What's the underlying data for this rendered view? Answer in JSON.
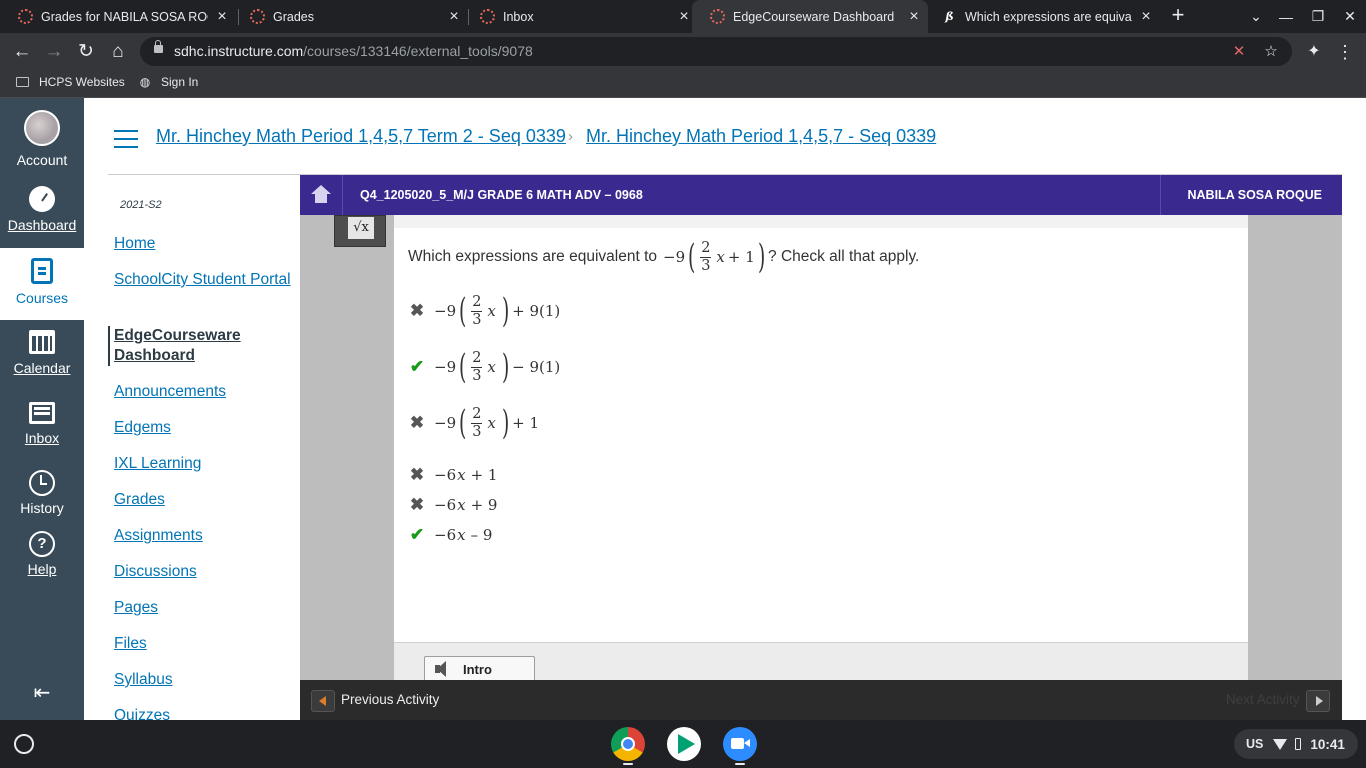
{
  "browser": {
    "tabs": [
      {
        "title": "Grades for NABILA SOSA ROQU",
        "active": false
      },
      {
        "title": "Grades",
        "active": false
      },
      {
        "title": "Inbox",
        "active": false
      },
      {
        "title": "EdgeCourseware Dashboard",
        "active": true
      },
      {
        "title": "Which expressions are equival",
        "active": false
      }
    ],
    "url_host": "sdhc.instructure.com",
    "url_path": "/courses/133146/external_tools/9078",
    "bookmarks": [
      "HCPS Websites",
      "Sign In"
    ]
  },
  "global_nav": {
    "account": "Account",
    "dashboard": "Dashboard",
    "courses": "Courses",
    "calendar": "Calendar",
    "inbox": "Inbox",
    "history": "History",
    "help": "Help"
  },
  "breadcrumbs": [
    "Mr. Hinchey Math Period 1,4,5,7 Term 2 - Seq 0339",
    "Mr. Hinchey Math Period 1,4,5,7 - Seq 0339"
  ],
  "course_nav": {
    "term": "2021-S2",
    "items": [
      "Home",
      "SchoolCity Student Portal",
      "EdgeCourseware Dashboard",
      "Announcements",
      "Edgems",
      "IXL Learning",
      "Grades",
      "Assignments",
      "Discussions",
      "Pages",
      "Files",
      "Syllabus",
      "Quizzes"
    ],
    "active": "EdgeCourseware Dashboard"
  },
  "edgenuity": {
    "course_title": "Q4_1205020_5_M/J GRADE 6 MATH ADV – 0968",
    "student_name": "NABILA SOSA ROQUE",
    "question_prefix": "Which expressions are equivalent to",
    "question_suffix": "? Check all that apply.",
    "question_expr": {
      "coef": "−9",
      "num": "2",
      "den": "3",
      "var": "x",
      "tail": "+ 1"
    },
    "options": [
      {
        "coef": "−9",
        "num": "2",
        "den": "3",
        "var": "x",
        "tail": "+ 9(1)",
        "result": "incorrect"
      },
      {
        "coef": "−9",
        "num": "2",
        "den": "3",
        "var": "x",
        "tail": "− 9(1)",
        "result": "correct"
      },
      {
        "coef": "−9",
        "num": "2",
        "den": "3",
        "var": "x",
        "tail": "+ 1",
        "result": "incorrect"
      },
      {
        "coef": "−6",
        "var": "x",
        "tail": "+ 1",
        "result": "incorrect"
      },
      {
        "coef": "−6",
        "var": "x",
        "tail": "+ 9",
        "result": "incorrect"
      },
      {
        "coef": "−6",
        "var": "x",
        "tail": "– 9",
        "result": "correct"
      }
    ],
    "marks": {
      "correct": "✔",
      "incorrect": "✖"
    },
    "intro_label": "Intro",
    "prev_activity": "Previous Activity",
    "next_activity": "Next Activity",
    "math_tool": "√x"
  },
  "shelf": {
    "ime": "US",
    "time": "10:41",
    "apps": [
      "chrome-icon",
      "play-store-icon",
      "zoom-icon"
    ]
  }
}
